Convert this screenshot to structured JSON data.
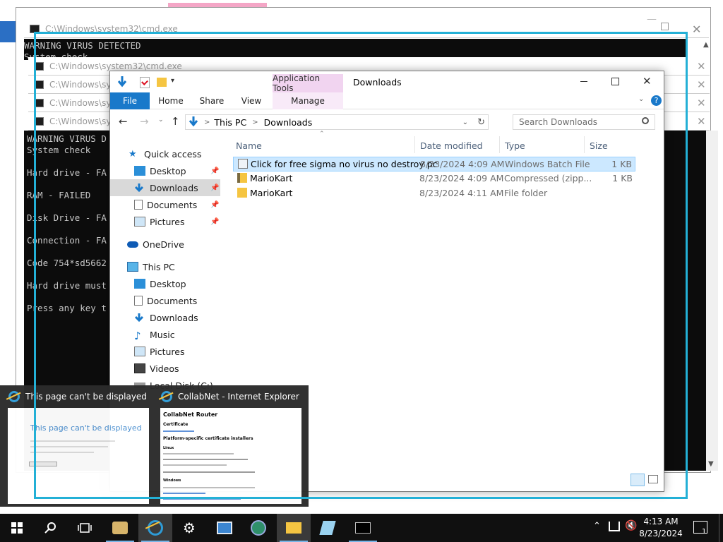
{
  "cmd": {
    "title_top": "C:\\Windows\\system32\\cmd.exe",
    "title_2": "C:\\Windows\\system32\\cmd.exe",
    "title_3": "C:\\Windows\\sys",
    "title_4": "C:\\Windows\\sys",
    "title_5": "C:\\Windows\\sys",
    "top_line1": "WARNING VIRUS DETECTED",
    "top_line2": "System check",
    "lines": [
      "WARNING VIRUS D",
      "System check",
      "Hard drive - FA",
      "RAM - FAILED",
      "Disk Drive - FA",
      "Connection - FA",
      "Code 754*sd5662",
      "Hard drive must",
      "Press any key t"
    ]
  },
  "explorer": {
    "title": "Downloads",
    "application_tools": "Application Tools",
    "tabs": {
      "file": "File",
      "home": "Home",
      "share": "Share",
      "view": "View",
      "manage": "Manage"
    },
    "breadcrumb": {
      "this_pc": "This PC",
      "sep": ">",
      "downloads": "Downloads"
    },
    "search_placeholder": "Search Downloads",
    "nav": {
      "quick_access": "Quick access",
      "qa_desktop": "Desktop",
      "qa_downloads": "Downloads",
      "qa_documents": "Documents",
      "qa_pictures": "Pictures",
      "onedrive": "OneDrive",
      "this_pc": "This PC",
      "pc_desktop": "Desktop",
      "pc_documents": "Documents",
      "pc_downloads": "Downloads",
      "pc_music": "Music",
      "pc_pictures": "Pictures",
      "pc_videos": "Videos",
      "pc_local_disk": "Local Disk (C:)"
    },
    "columns": {
      "name": "Name",
      "date": "Date modified",
      "type": "Type",
      "size": "Size"
    },
    "files": [
      {
        "name": "Click for free sigma no virus no destroy pc",
        "date": "8/23/2024 4:09 AM",
        "type": "Windows Batch File",
        "size": "1 KB"
      },
      {
        "name": "MarioKart",
        "date": "8/23/2024 4:09 AM",
        "type": "Compressed (zipp...",
        "size": "1 KB"
      },
      {
        "name": "MarioKart",
        "date": "8/23/2024 4:11 AM",
        "type": "File folder",
        "size": ""
      }
    ]
  },
  "thumbnails": [
    {
      "title": "This page can't be displayed - I...",
      "heading": "This page can't be displayed"
    },
    {
      "title": "CollabNet - Internet Explorer",
      "heading": "CollabNet Router",
      "sub1": "Certificate",
      "sub2": "Platform-specific certificate installers",
      "sub3": "Linux",
      "sub4": "Windows"
    }
  ],
  "taskbar": {
    "time": "4:13 AM",
    "date": "8/23/2024",
    "notifications": "1"
  },
  "colors": {
    "accent": "#1979ca",
    "frame": "#23b0d6",
    "selection": "#cce8ff",
    "app_tools": "#f1d4f0"
  }
}
